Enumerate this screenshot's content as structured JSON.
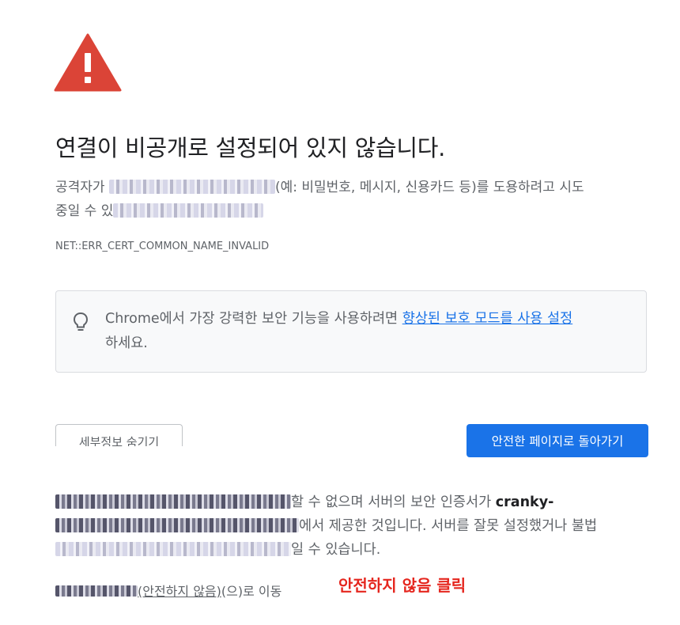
{
  "header": {
    "title": "연결이 비공개로 설정되어 있지 않습니다."
  },
  "description": {
    "line_start": "공격자가 ",
    "line_mid": "(예: 비밀번호, 메시지, 신용카드 등)를 도용하려고 시도",
    "line2_start": "중일 수 있"
  },
  "error_code": "NET::ERR_CERT_COMMON_NAME_INVALID",
  "info_box": {
    "text_before": "Chrome에서 가장 강력한 보안 기능을 사용하려면 ",
    "link": "향상된 보호 모드를 사용 설정",
    "text_after": "하세요."
  },
  "buttons": {
    "details_label": "세부정보 숨기기",
    "back_label": "안전한 페이지로 돌아가기"
  },
  "details": {
    "part1": "할 수 없으며 서버의 보안 인증서가 ",
    "cert_name": "cranky-",
    "part2": "에서 제공한 것입니다. 서버를 잘못 설정했거나 불법",
    "part3": "일 수 있습니다."
  },
  "proceed": {
    "link": "(안전하지 않음)",
    "suffix": "(으)로 이동"
  },
  "annotation": "안전하지 않음 클릭",
  "colors": {
    "warning_red": "#db4437",
    "primary_blue": "#1a73e8",
    "annotation_red": "#e5261e"
  }
}
